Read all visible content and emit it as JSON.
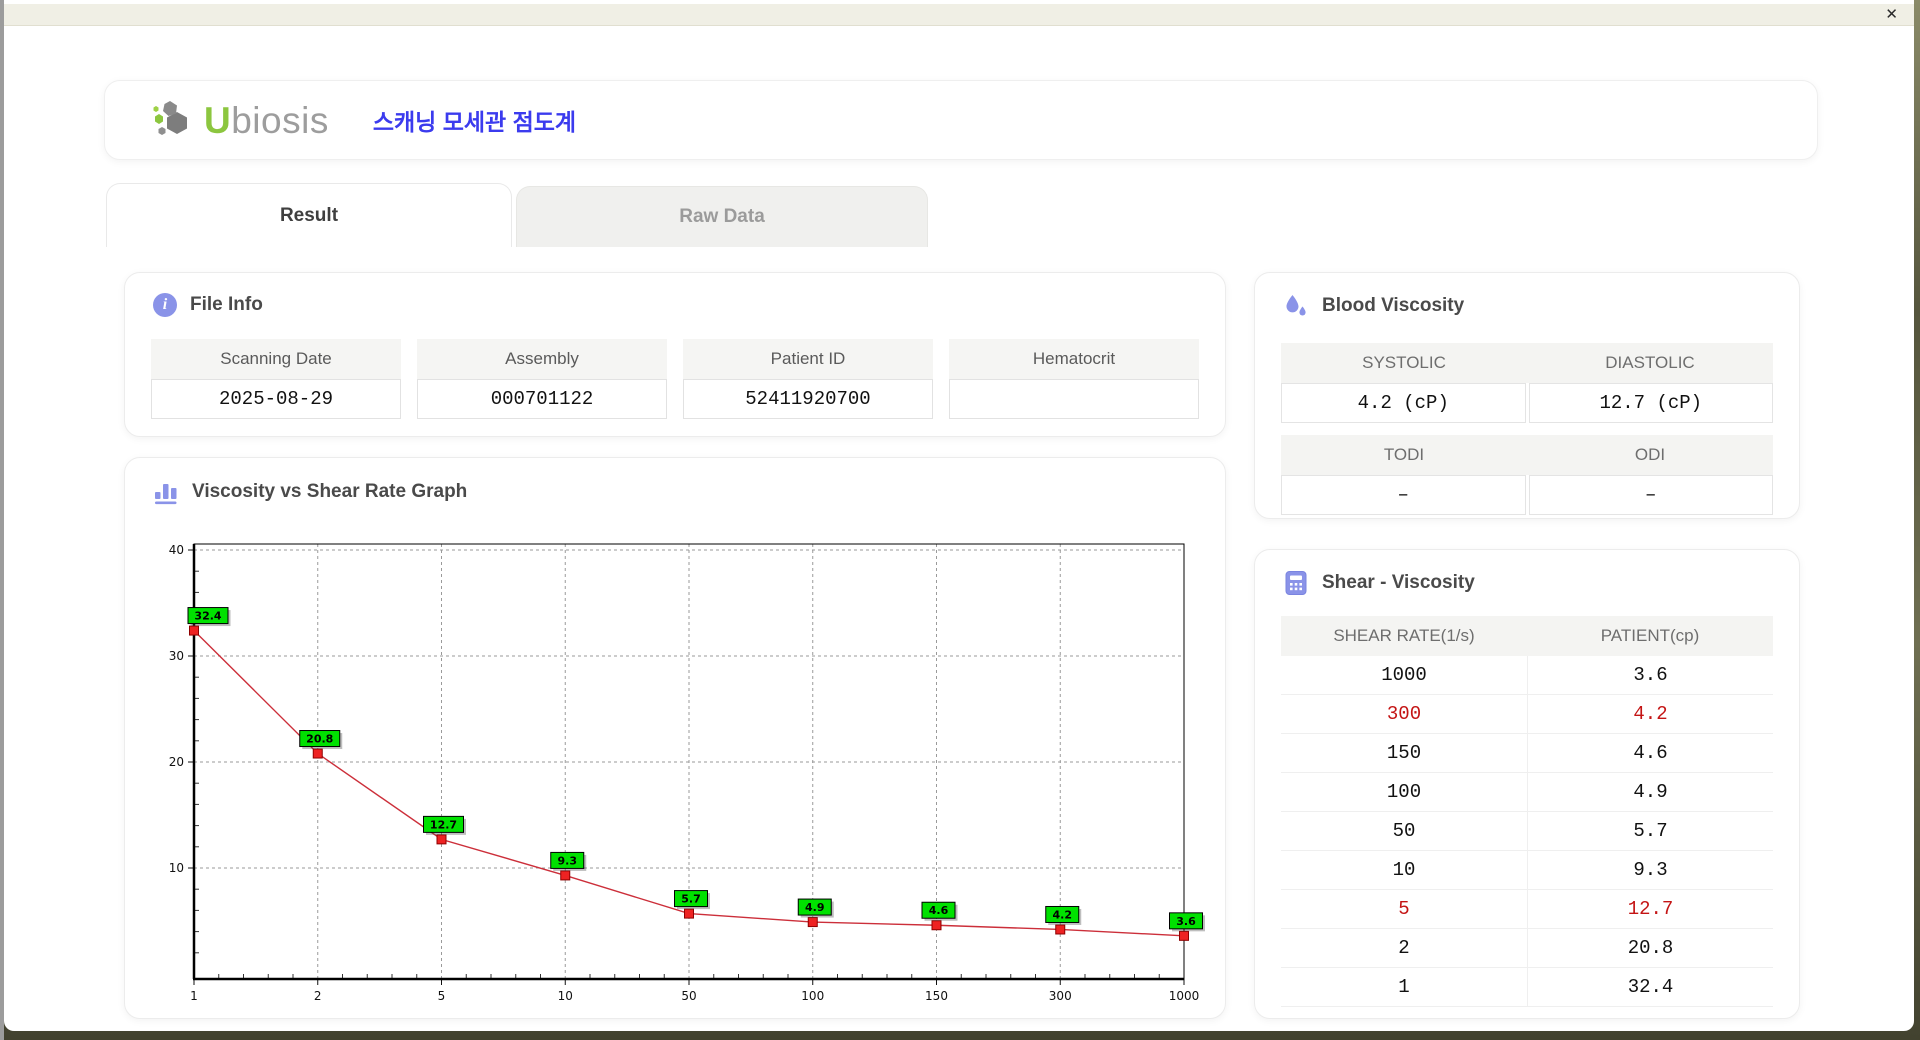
{
  "window": {
    "close_glyph": "✕"
  },
  "brand": {
    "accent_letter": "U",
    "rest": "biosis"
  },
  "header": {
    "app_title": "스캐닝 모세관 점도계"
  },
  "tabs": [
    {
      "label": "Result",
      "active": true
    },
    {
      "label": "Raw Data",
      "active": false
    }
  ],
  "file_info": {
    "title": "File Info",
    "fields": [
      {
        "label": "Scanning Date",
        "value": "2025-08-29"
      },
      {
        "label": "Assembly",
        "value": "000701122"
      },
      {
        "label": "Patient ID",
        "value": "52411920700"
      },
      {
        "label": "Hematocrit",
        "value": ""
      }
    ]
  },
  "blood_viscosity": {
    "title": "Blood Viscosity",
    "cells": [
      {
        "label": "SYSTOLIC",
        "value": "4.2 (cP)"
      },
      {
        "label": "DIASTOLIC",
        "value": "12.7 (cP)"
      },
      {
        "label": "TODI",
        "value": "–"
      },
      {
        "label": "ODI",
        "value": "–"
      }
    ]
  },
  "graph": {
    "title": "Viscosity vs Shear Rate Graph"
  },
  "chart_data": {
    "type": "line",
    "title": "Viscosity vs Shear Rate Graph",
    "x": [
      1,
      2,
      5,
      10,
      50,
      100,
      150,
      300,
      1000
    ],
    "y": [
      32.4,
      20.8,
      12.7,
      9.3,
      5.7,
      4.9,
      4.6,
      4.2,
      3.6
    ],
    "x_scale": "categorical-evenly-spaced",
    "y_ticks": [
      10,
      20,
      30,
      40
    ],
    "ylim": [
      0,
      41.5
    ],
    "grid": "dashed",
    "line_color": "#cc2f3a",
    "marker_fill": "#ee2222",
    "marker_stroke": "#8f0000",
    "label_bg": "#00e100",
    "legend": "none"
  },
  "shear_table": {
    "title": "Shear - Viscosity",
    "columns": [
      "SHEAR RATE(1/s)",
      "PATIENT(cp)"
    ],
    "rows": [
      {
        "shear": "1000",
        "patient": "3.6",
        "highlight": false
      },
      {
        "shear": "300",
        "patient": "4.2",
        "highlight": true
      },
      {
        "shear": "150",
        "patient": "4.6",
        "highlight": false
      },
      {
        "shear": "100",
        "patient": "4.9",
        "highlight": false
      },
      {
        "shear": "50",
        "patient": "5.7",
        "highlight": false
      },
      {
        "shear": "10",
        "patient": "9.3",
        "highlight": false
      },
      {
        "shear": "5",
        "patient": "12.7",
        "highlight": true
      },
      {
        "shear": "2",
        "patient": "20.8",
        "highlight": false
      },
      {
        "shear": "1",
        "patient": "32.4",
        "highlight": false
      }
    ]
  },
  "colors": {
    "accent_purple": "#8a93e8",
    "highlight_red": "#c41414",
    "title_blue": "#3b3bee",
    "brand_green": "#8cc63f",
    "brand_gray": "#9d9d9d"
  }
}
